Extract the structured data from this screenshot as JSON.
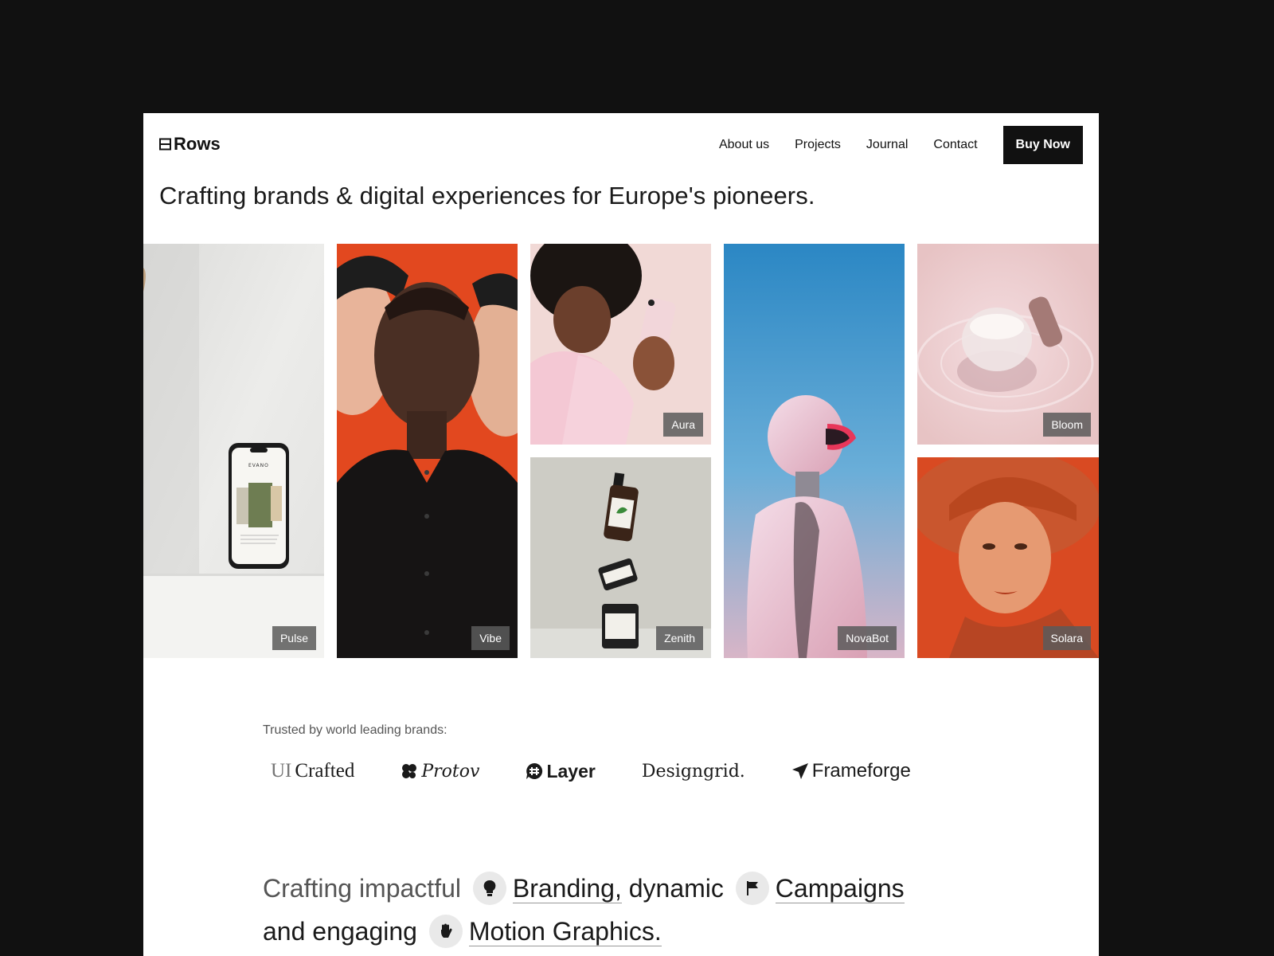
{
  "header": {
    "logo_text": "Rows",
    "nav": [
      "About us",
      "Projects",
      "Journal",
      "Contact"
    ],
    "cta_label": "Buy Now"
  },
  "headline": "Crafting brands & digital experiences for Europe's pioneers.",
  "gallery": {
    "tiles": [
      {
        "label": "Pulse"
      },
      {
        "label": "Vibe"
      },
      {
        "label": "Aura"
      },
      {
        "label": "Zenith"
      },
      {
        "label": "NovaBot"
      },
      {
        "label": "Bloom"
      },
      {
        "label": "Solara"
      }
    ],
    "phone_mockup_text": "EVANO"
  },
  "trusted": {
    "label": "Trusted by world leading brands:",
    "brands": [
      {
        "name": "UICrafted",
        "prefix": "UI",
        "rest": "Crafted"
      },
      {
        "name": "Protov"
      },
      {
        "name": "Layer"
      },
      {
        "name": "Designgrid."
      },
      {
        "name": "Frameforge"
      }
    ]
  },
  "statement": {
    "part1": "Crafting impactful",
    "kw1": "Branding,",
    "part2": "dynamic",
    "kw2": "Campaigns",
    "part3": "and engaging",
    "kw3": "Motion Graphics.",
    "icons": [
      "lightbulb-icon",
      "flag-icon",
      "hand-icon"
    ]
  },
  "colors": {
    "background": "#111111",
    "page": "#ffffff",
    "cta": "#111111",
    "label_badge": "#5a5a5a",
    "accent_orange": "#e2481f",
    "sky_blue": "#2a8fc8"
  }
}
